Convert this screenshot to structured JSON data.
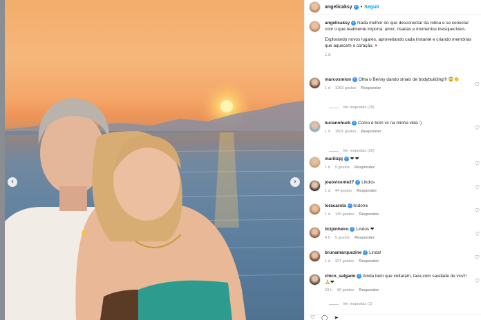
{
  "colors": {
    "accent": "#0095f6",
    "verified": "#3897f0",
    "heart": "#ed4956",
    "muted": "#8e8e8e"
  },
  "carousel": {
    "prev_icon": "‹",
    "next_icon": "›"
  },
  "header": {
    "username": "angelicaksy",
    "separator": "•",
    "follow_label": "Seguir"
  },
  "caption": {
    "username": "angelicaksy",
    "paragraph1": "Nada melhor do que desconectar da rotina e se conectar com o que realmente importa: amor, risadas e momentos inesquecíveis.",
    "paragraph2": "Explorando novos lugares, aproveitando cada instante e criando memórias que aquecem o coração.",
    "emoji": "♥",
    "time": "1 d"
  },
  "comments": [
    {
      "username": "marcosmion",
      "text": "Olha o Benny dando sinais de bodybuilding!!! 😱👏",
      "time": "1 d",
      "likes": "1263 gostos",
      "reply": "Responder",
      "replies": "Ver respostas (15)",
      "avatar_color": "#5a3b2e"
    },
    {
      "username": "lucianohuck",
      "text": "Como é bom vc na minha vida :)",
      "time": "1 d",
      "likes": "1501 gostos",
      "reply": "Responder",
      "replies": "Ver respostas (20)",
      "avatar_color": "#7fa9c9"
    },
    {
      "username": "marilizpj",
      "text": "❤ ❤",
      "time": "1 d",
      "likes": "9 gostos",
      "reply": "Responder",
      "replies": "",
      "avatar_color": "#c9a27a"
    },
    {
      "username": "joaovicente27",
      "text": "Lindos",
      "time": "1 d",
      "likes": "44 gostos",
      "reply": "Responder",
      "replies": "",
      "avatar_color": "#2b2b2b"
    },
    {
      "username": "loracarola",
      "text": "lindona",
      "time": "1 d",
      "likes": "149 gostos",
      "reply": "Responder",
      "replies": "",
      "avatar_color": "#b07a4a"
    },
    {
      "username": "ticipinheiro",
      "text": "Lindos ❤",
      "time": "4 h",
      "likes": "5 gostos",
      "reply": "Responder",
      "replies": "",
      "avatar_color": "#8a5a44"
    },
    {
      "username": "brunamarquezine",
      "text": "Linda!",
      "time": "1 d",
      "likes": "327 gostos",
      "reply": "Responder",
      "replies": "",
      "avatar_color": "#6b3e2c"
    },
    {
      "username": "chico_salgado",
      "text": "Ainda bem que voltaram, tava com saudade de vcs!!! 🙏❤",
      "time": "23 h",
      "likes": "66 gostos",
      "reply": "Responder",
      "replies": "Ver respostas (1)",
      "avatar_color": "#3d3d3d"
    }
  ],
  "like_icon": "♡",
  "bottom_actions": [
    "♡",
    "◯",
    "➤"
  ]
}
